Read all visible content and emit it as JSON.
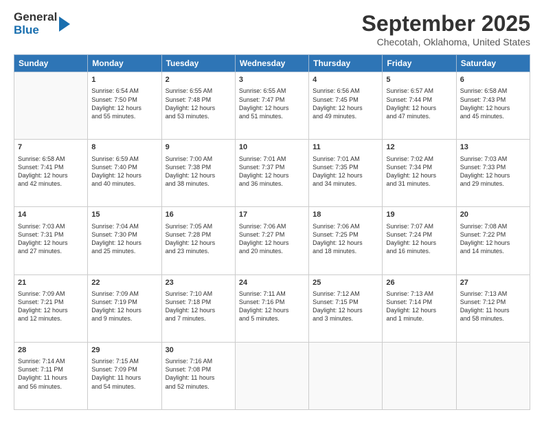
{
  "header": {
    "logo_general": "General",
    "logo_blue": "Blue",
    "title": "September 2025",
    "subtitle": "Checotah, Oklahoma, United States"
  },
  "days_of_week": [
    "Sunday",
    "Monday",
    "Tuesday",
    "Wednesday",
    "Thursday",
    "Friday",
    "Saturday"
  ],
  "weeks": [
    [
      {
        "day": "",
        "info": ""
      },
      {
        "day": "1",
        "info": "Sunrise: 6:54 AM\nSunset: 7:50 PM\nDaylight: 12 hours\nand 55 minutes."
      },
      {
        "day": "2",
        "info": "Sunrise: 6:55 AM\nSunset: 7:48 PM\nDaylight: 12 hours\nand 53 minutes."
      },
      {
        "day": "3",
        "info": "Sunrise: 6:55 AM\nSunset: 7:47 PM\nDaylight: 12 hours\nand 51 minutes."
      },
      {
        "day": "4",
        "info": "Sunrise: 6:56 AM\nSunset: 7:45 PM\nDaylight: 12 hours\nand 49 minutes."
      },
      {
        "day": "5",
        "info": "Sunrise: 6:57 AM\nSunset: 7:44 PM\nDaylight: 12 hours\nand 47 minutes."
      },
      {
        "day": "6",
        "info": "Sunrise: 6:58 AM\nSunset: 7:43 PM\nDaylight: 12 hours\nand 45 minutes."
      }
    ],
    [
      {
        "day": "7",
        "info": "Sunrise: 6:58 AM\nSunset: 7:41 PM\nDaylight: 12 hours\nand 42 minutes."
      },
      {
        "day": "8",
        "info": "Sunrise: 6:59 AM\nSunset: 7:40 PM\nDaylight: 12 hours\nand 40 minutes."
      },
      {
        "day": "9",
        "info": "Sunrise: 7:00 AM\nSunset: 7:38 PM\nDaylight: 12 hours\nand 38 minutes."
      },
      {
        "day": "10",
        "info": "Sunrise: 7:01 AM\nSunset: 7:37 PM\nDaylight: 12 hours\nand 36 minutes."
      },
      {
        "day": "11",
        "info": "Sunrise: 7:01 AM\nSunset: 7:35 PM\nDaylight: 12 hours\nand 34 minutes."
      },
      {
        "day": "12",
        "info": "Sunrise: 7:02 AM\nSunset: 7:34 PM\nDaylight: 12 hours\nand 31 minutes."
      },
      {
        "day": "13",
        "info": "Sunrise: 7:03 AM\nSunset: 7:33 PM\nDaylight: 12 hours\nand 29 minutes."
      }
    ],
    [
      {
        "day": "14",
        "info": "Sunrise: 7:03 AM\nSunset: 7:31 PM\nDaylight: 12 hours\nand 27 minutes."
      },
      {
        "day": "15",
        "info": "Sunrise: 7:04 AM\nSunset: 7:30 PM\nDaylight: 12 hours\nand 25 minutes."
      },
      {
        "day": "16",
        "info": "Sunrise: 7:05 AM\nSunset: 7:28 PM\nDaylight: 12 hours\nand 23 minutes."
      },
      {
        "day": "17",
        "info": "Sunrise: 7:06 AM\nSunset: 7:27 PM\nDaylight: 12 hours\nand 20 minutes."
      },
      {
        "day": "18",
        "info": "Sunrise: 7:06 AM\nSunset: 7:25 PM\nDaylight: 12 hours\nand 18 minutes."
      },
      {
        "day": "19",
        "info": "Sunrise: 7:07 AM\nSunset: 7:24 PM\nDaylight: 12 hours\nand 16 minutes."
      },
      {
        "day": "20",
        "info": "Sunrise: 7:08 AM\nSunset: 7:22 PM\nDaylight: 12 hours\nand 14 minutes."
      }
    ],
    [
      {
        "day": "21",
        "info": "Sunrise: 7:09 AM\nSunset: 7:21 PM\nDaylight: 12 hours\nand 12 minutes."
      },
      {
        "day": "22",
        "info": "Sunrise: 7:09 AM\nSunset: 7:19 PM\nDaylight: 12 hours\nand 9 minutes."
      },
      {
        "day": "23",
        "info": "Sunrise: 7:10 AM\nSunset: 7:18 PM\nDaylight: 12 hours\nand 7 minutes."
      },
      {
        "day": "24",
        "info": "Sunrise: 7:11 AM\nSunset: 7:16 PM\nDaylight: 12 hours\nand 5 minutes."
      },
      {
        "day": "25",
        "info": "Sunrise: 7:12 AM\nSunset: 7:15 PM\nDaylight: 12 hours\nand 3 minutes."
      },
      {
        "day": "26",
        "info": "Sunrise: 7:13 AM\nSunset: 7:14 PM\nDaylight: 12 hours\nand 1 minute."
      },
      {
        "day": "27",
        "info": "Sunrise: 7:13 AM\nSunset: 7:12 PM\nDaylight: 11 hours\nand 58 minutes."
      }
    ],
    [
      {
        "day": "28",
        "info": "Sunrise: 7:14 AM\nSunset: 7:11 PM\nDaylight: 11 hours\nand 56 minutes."
      },
      {
        "day": "29",
        "info": "Sunrise: 7:15 AM\nSunset: 7:09 PM\nDaylight: 11 hours\nand 54 minutes."
      },
      {
        "day": "30",
        "info": "Sunrise: 7:16 AM\nSunset: 7:08 PM\nDaylight: 11 hours\nand 52 minutes."
      },
      {
        "day": "",
        "info": ""
      },
      {
        "day": "",
        "info": ""
      },
      {
        "day": "",
        "info": ""
      },
      {
        "day": "",
        "info": ""
      }
    ]
  ]
}
